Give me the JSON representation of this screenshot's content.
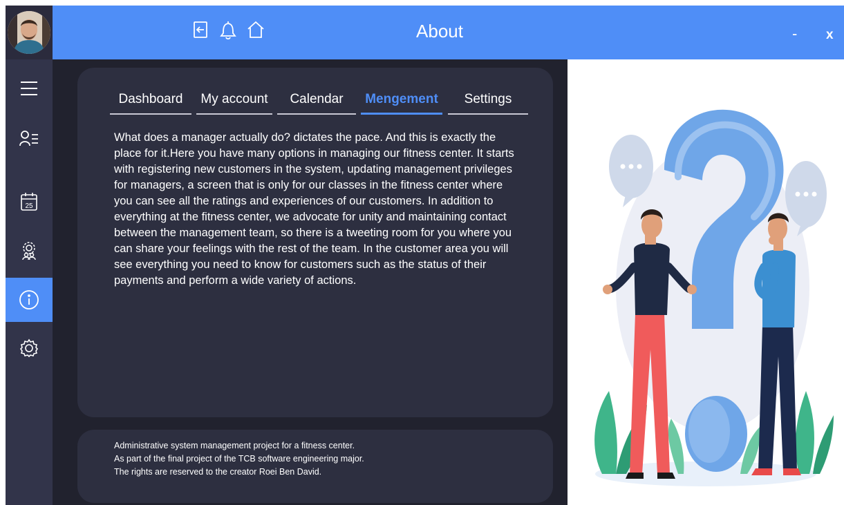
{
  "window": {
    "title": "About",
    "minimize_label": "-",
    "close_label": "x"
  },
  "top_icons": [
    "logout-icon",
    "bell-icon",
    "home-icon"
  ],
  "sidebar": {
    "items": [
      {
        "icon": "menu-icon"
      },
      {
        "icon": "user-list-icon"
      },
      {
        "icon": "calendar-icon",
        "icon_text": "25"
      },
      {
        "icon": "user-gear-icon"
      },
      {
        "icon": "info-icon",
        "active": true
      },
      {
        "icon": "gear-icon"
      }
    ]
  },
  "tabs": [
    {
      "label": "Dashboard"
    },
    {
      "label": "My account"
    },
    {
      "label": "Calendar"
    },
    {
      "label": "Mengement",
      "active": true
    },
    {
      "label": "Settings"
    }
  ],
  "about": {
    "text": "What does a manager actually do? dictates the pace. And this is exactly the place for it.Here you have many options in managing our fitness center. It starts with registering new customers in the system, updating management privileges for managers, a screen that is only for our classes in the fitness center where you can see all the ratings and experiences of our customers. In addition to everything at the fitness center, we advocate for unity and maintaining contact between the management team, so there is a tweeting room for you where you can share your feelings with the rest of the team. In the customer area you will see everything you need to know for customers such as the status of their payments and perform a wide variety of actions."
  },
  "footer": {
    "lines": [
      "Administrative system management project for a fitness center.",
      "As part of the final project of the TCB software engineering major.",
      "The rights are reserved to the creator Roei Ben David."
    ]
  },
  "colors": {
    "accent": "#4f8ef7",
    "sidebar": "#32344a",
    "main_bg": "#21222e",
    "card_bg": "#2d2f40"
  }
}
